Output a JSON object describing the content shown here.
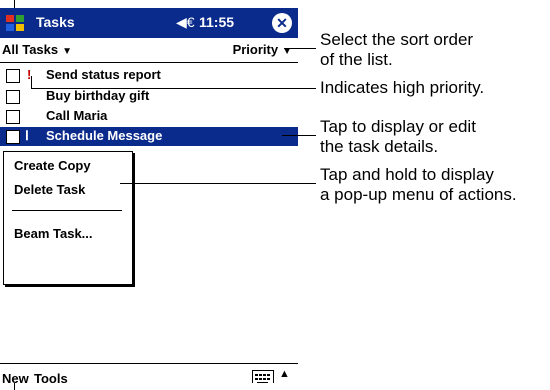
{
  "titlebar": {
    "app_name": "Tasks",
    "volume_icon": "speaker-icon",
    "time": "11:55",
    "close_label": "✕"
  },
  "filterbar": {
    "category": "All Tasks",
    "sort": "Priority"
  },
  "tasks": [
    {
      "name": "Send status report",
      "priority_mark": "!",
      "selected": false
    },
    {
      "name": "Buy birthday gift",
      "priority_mark": "",
      "selected": false
    },
    {
      "name": "Call Maria",
      "priority_mark": "",
      "selected": false
    },
    {
      "name": "Schedule Message",
      "priority_mark": "",
      "selected": true
    }
  ],
  "popup_menu": {
    "items": [
      "Create Copy",
      "Delete Task",
      "Beam Task..."
    ]
  },
  "command_bar": {
    "new": "New",
    "tools": "Tools"
  },
  "callouts": {
    "sort_line1": "Select the sort order",
    "sort_line2": "of the list.",
    "priority": "Indicates high priority.",
    "details_line1": "Tap to display or edit",
    "details_line2": "the task details.",
    "popup_line1": "Tap and hold to display",
    "popup_line2": "a pop-up menu of actions."
  },
  "colors": {
    "titlebar": "#0a2a8c",
    "selection": "#0a2a8c",
    "priority": "#c00000"
  }
}
